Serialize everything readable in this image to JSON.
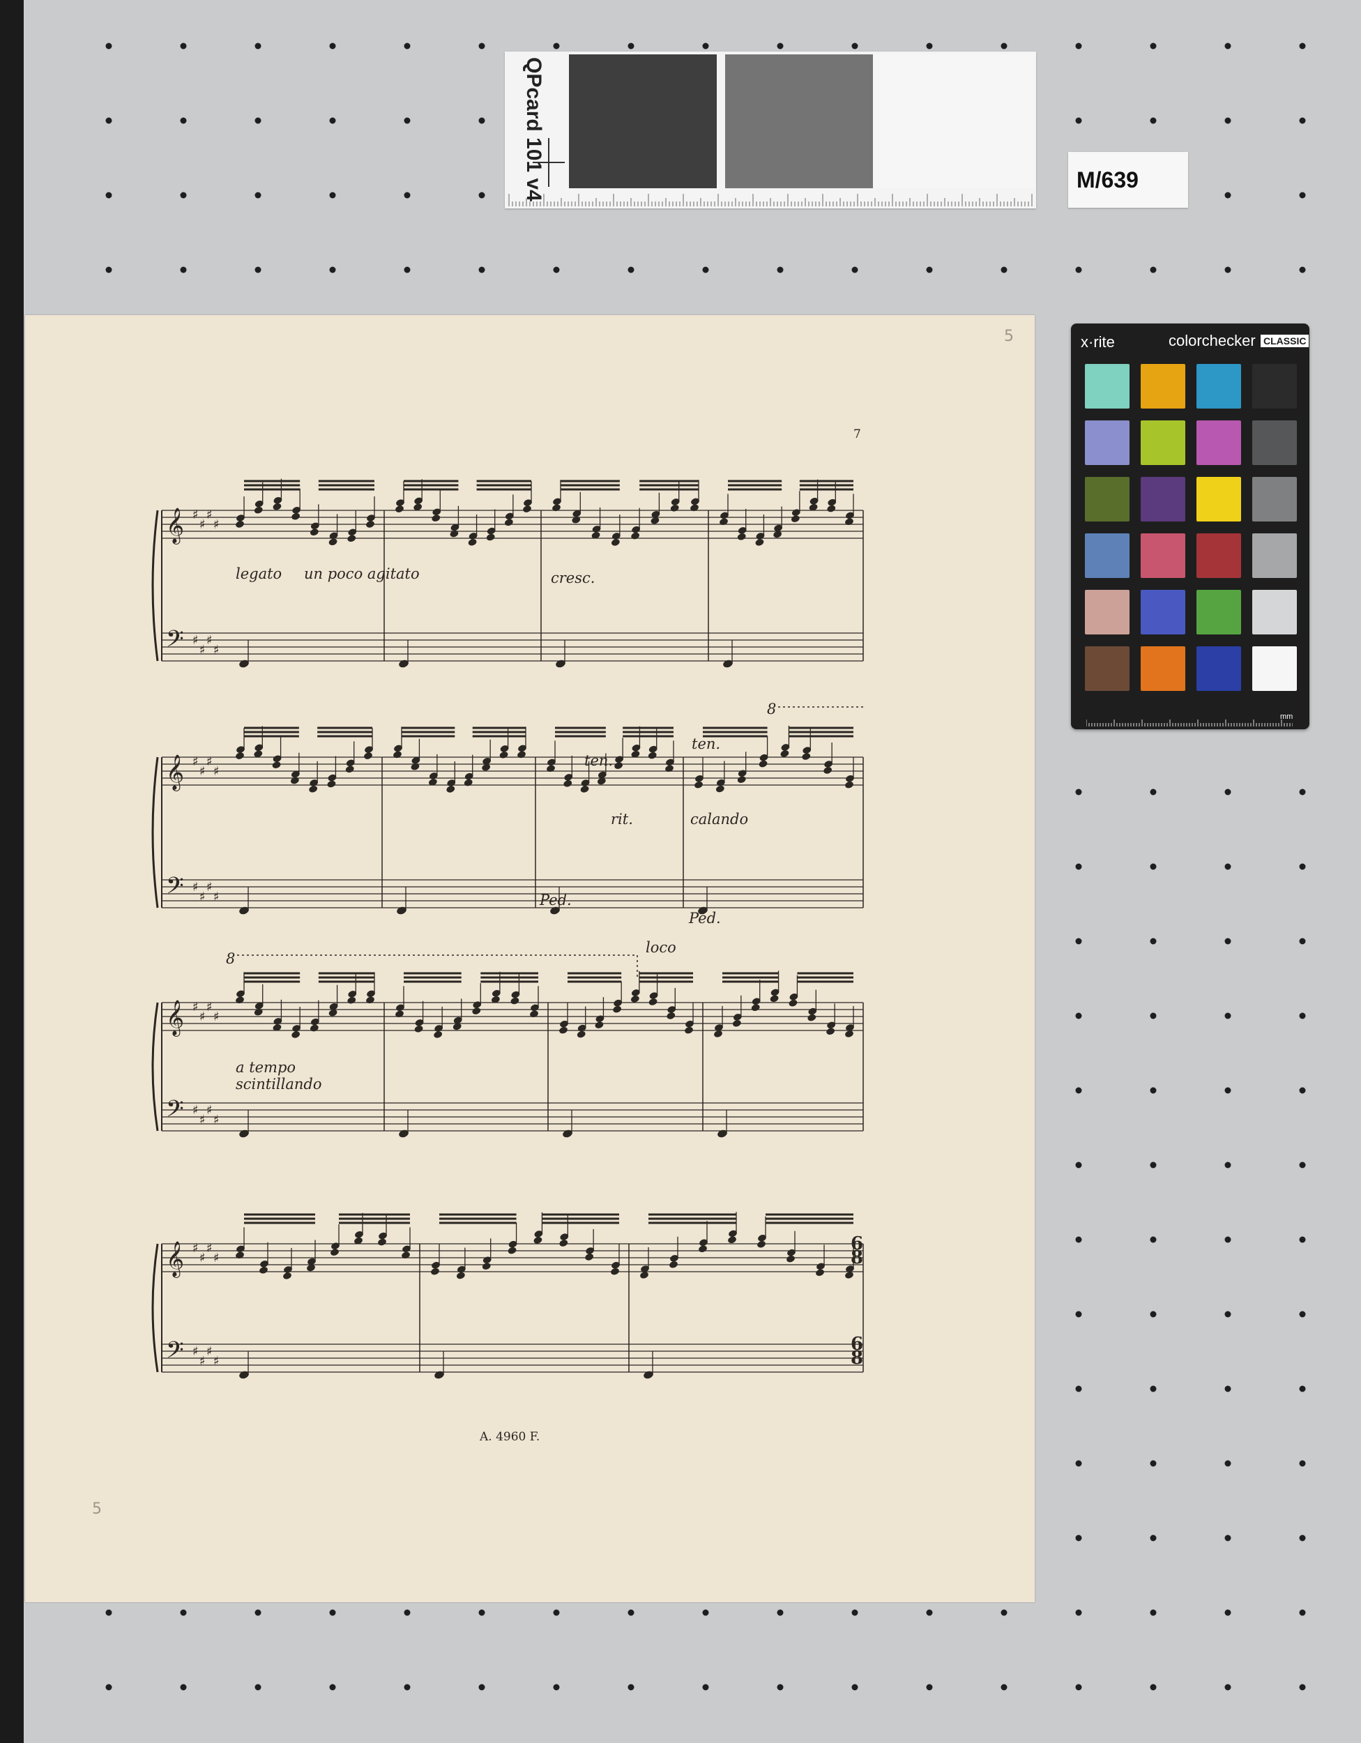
{
  "qp_card": {
    "text": "QPcard 101 v4",
    "patches": [
      "#3e3e3e",
      "#747474",
      "#f6f6f6"
    ]
  },
  "id_label": {
    "text": "M/639"
  },
  "colorchecker": {
    "brand": "x·rite",
    "name": "colorchecker",
    "badge": "CLASSIC",
    "unit": "mm",
    "swatches": [
      [
        "#7fd1c0",
        "#e6a312",
        "#2d97c6",
        "#2b2b2b"
      ],
      [
        "#8b8fcd",
        "#a7c52a",
        "#b858b0",
        "#555759"
      ],
      [
        "#5a6e2c",
        "#5b3a7d",
        "#f0d11a",
        "#7f8081"
      ],
      [
        "#5e82b8",
        "#c9566f",
        "#a53439",
        "#a5a7a8"
      ],
      [
        "#cca298",
        "#4a59c2",
        "#56a441",
        "#d5d6d7"
      ],
      [
        "#6c4a36",
        "#e1741c",
        "#2b3fa6",
        "#f6f6f6"
      ]
    ]
  },
  "sheet": {
    "page_number": "7",
    "pencil_top": "5",
    "pencil_bottom": "5",
    "plate_number": "A. 4960 F.",
    "markings": {
      "legato": "legato",
      "un_poco_agitato": "un poco agitato",
      "cresc": "cresc.",
      "ottava_1": "8",
      "ten_1": "ten.",
      "ten_2": "ten.",
      "rit": "rit.",
      "calando": "calando",
      "ped_1": "Ped.",
      "ped_2": "Ped.",
      "ottava_2": "8",
      "loco": "loco",
      "a_tempo": "a tempo",
      "scintillando": "scintillando",
      "time_sig_top": "6",
      "time_sig_bottom": "8"
    }
  }
}
